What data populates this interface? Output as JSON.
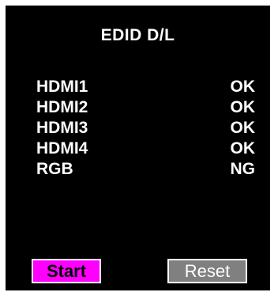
{
  "title": "EDID D/L",
  "ports": [
    {
      "name": "HDMI1",
      "status": "OK"
    },
    {
      "name": "HDMI2",
      "status": "OK"
    },
    {
      "name": "HDMI3",
      "status": "OK"
    },
    {
      "name": "HDMI4",
      "status": "OK"
    },
    {
      "name": "RGB",
      "status": "NG"
    }
  ],
  "buttons": {
    "start_label": "Start",
    "reset_label": "Reset"
  },
  "colors": {
    "background": "#000000",
    "text": "#ffffff",
    "start_button": "#ff00ff",
    "reset_button": "#808080"
  }
}
